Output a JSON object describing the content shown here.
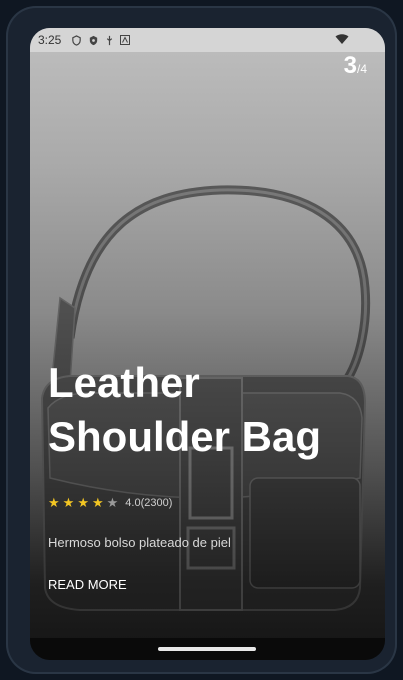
{
  "status": {
    "time": "3:25",
    "icons": [
      "shield-icon",
      "vpn-icon",
      "usb-icon",
      "text-icon"
    ],
    "wifi": "wifi-icon"
  },
  "slide": {
    "current": "3",
    "total": "/4"
  },
  "product": {
    "title_line1": "Leather",
    "title_line2": "Shoulder Bag",
    "rating": 4,
    "rating_text": "4.0(2300)",
    "description": "Hermoso bolso plateado de piel",
    "read_more": "READ MORE"
  },
  "colors": {
    "star": "#f3c623",
    "text": "#ffffff"
  }
}
